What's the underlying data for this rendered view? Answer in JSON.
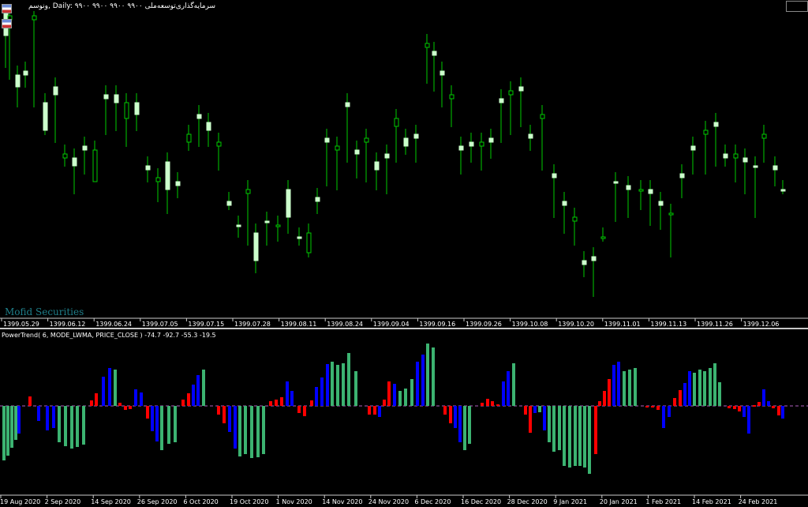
{
  "header": {
    "title": "ونوسم, Daily:  ۹۹۰۰ ۹۹۰۰ ۹۹۰۰ ۹۹۰۰  سرمایه‌گذاری‌توسعه‌ملی"
  },
  "watermark": "Mofid Securities",
  "indicator_label": "PowerTrend( 6, MODE_LWMA, PRICE_CLOSE ) -74.7 -92.7 -55.3 -19.5",
  "colors": {
    "background": "#000000",
    "bull_fill": "#ccffcc",
    "bear_outline": "#00cc00",
    "wick": "#00cc00",
    "hist_red": "#ff0000",
    "hist_blue": "#0000ff",
    "hist_green": "#3cb371",
    "zero_line": "#b060c0",
    "axis_text": "#ffffff"
  },
  "main_axis_labels": [
    "1399.05.29",
    "1399.06.12",
    "1399.06.24",
    "1399.07.05",
    "1399.07.15",
    "1399.07.28",
    "1399.08.11",
    "1399.08.24",
    "1399.09.04",
    "1399.09.16",
    "1399.09.26",
    "1399.10.08",
    "1399.10.20",
    "1399.11.01",
    "1399.11.13",
    "1399.11.26",
    "1399.12.06"
  ],
  "sub_axis_labels": [
    "19 Aug 2020",
    "2 Sep 2020",
    "14 Sep 2020",
    "26 Sep 2020",
    "6 Oct 2020",
    "19 Oct 2020",
    "1 Nov 2020",
    "14 Nov 2020",
    "24 Nov 2020",
    "6 Dec 2020",
    "16 Dec 2020",
    "28 Dec 2020",
    "9 Jan 2021",
    "20 Jan 2021",
    "1 Feb 2021",
    "14 Feb 2021",
    "24 Feb 2021"
  ],
  "chart_data": [
    {
      "type": "candlestick",
      "candles": [
        [
          5,
          45,
          15,
          80
        ],
        [
          10,
          20,
          25,
          95
        ],
        [
          20,
          110,
          95,
          130
        ],
        [
          30,
          90,
          95,
          105
        ],
        [
          41,
          20,
          25,
          130
        ],
        [
          55,
          165,
          130,
          165
        ],
        [
          68,
          110,
          120,
          175
        ],
        [
          80,
          200,
          195,
          205
        ],
        [
          92,
          200,
          210,
          240
        ],
        [
          105,
          190,
          185,
          215
        ],
        [
          118,
          190,
          230,
          195
        ],
        [
          132,
          125,
          120,
          165
        ],
        [
          145,
          120,
          130,
          160
        ],
        [
          158,
          150,
          130,
          180
        ],
        [
          171,
          145,
          130,
          160
        ],
        [
          185,
          215,
          210,
          225
        ],
        [
          198,
          230,
          225,
          250
        ],
        [
          210,
          205,
          240,
          265
        ],
        [
          223,
          230,
          235,
          245
        ],
        [
          237,
          170,
          180,
          185
        ],
        [
          250,
          145,
          150,
          180
        ],
        [
          262,
          155,
          165,
          180
        ],
        [
          275,
          185,
          180,
          210
        ],
        [
          288,
          255,
          260,
          260
        ],
        [
          300,
          285,
          285,
          295
        ],
        [
          312,
          245,
          240,
          305
        ],
        [
          322,
          295,
          330,
          340
        ],
        [
          336,
          280,
          280,
          305
        ],
        [
          350,
          285,
          285,
          300
        ],
        [
          363,
          240,
          275,
          290
        ],
        [
          377,
          300,
          300,
          305
        ],
        [
          389,
          295,
          320,
          320
        ],
        [
          400,
          255,
          250,
          265
        ],
        [
          412,
          180,
          175,
          230
        ],
        [
          425,
          185,
          190,
          235
        ],
        [
          438,
          135,
          130,
          200
        ],
        [
          450,
          195,
          190,
          220
        ],
        [
          462,
          180,
          175,
          225
        ],
        [
          475,
          205,
          215,
          235
        ],
        [
          488,
          200,
          195,
          240
        ],
        [
          500,
          160,
          150,
          200
        ],
        [
          512,
          185,
          175,
          190
        ],
        [
          525,
          175,
          170,
          200
        ],
        [
          539,
          60,
          55,
          100
        ],
        [
          548,
          70,
          65,
          110
        ],
        [
          558,
          95,
          90,
          130
        ],
        [
          570,
          125,
          120,
          155
        ],
        [
          582,
          190,
          185,
          215
        ],
        [
          595,
          185,
          180,
          200
        ],
        [
          608,
          185,
          180,
          210
        ],
        [
          620,
          180,
          175,
          195
        ],
        [
          633,
          130,
          125,
          175
        ],
        [
          645,
          120,
          115,
          165
        ],
        [
          658,
          115,
          110,
          155
        ],
        [
          670,
          175,
          170,
          185
        ],
        [
          685,
          150,
          145,
          210
        ],
        [
          700,
          225,
          220,
          270
        ],
        [
          713,
          260,
          255,
          290
        ],
        [
          726,
          280,
          275,
          305
        ],
        [
          738,
          335,
          330,
          345
        ],
        [
          750,
          325,
          330,
          370
        ],
        [
          762,
          300,
          300,
          300
        ],
        [
          778,
          230,
          230,
          275
        ],
        [
          794,
          240,
          235,
          270
        ],
        [
          810,
          240,
          240,
          260
        ],
        [
          822,
          245,
          240,
          280
        ],
        [
          835,
          260,
          255,
          285
        ],
        [
          848,
          270,
          270,
          320
        ],
        [
          862,
          225,
          220,
          245
        ],
        [
          876,
          190,
          185,
          215
        ],
        [
          892,
          170,
          165,
          215
        ],
        [
          905,
          160,
          155,
          205
        ],
        [
          917,
          200,
          195,
          205
        ],
        [
          930,
          200,
          195,
          225
        ],
        [
          942,
          205,
          200,
          240
        ],
        [
          955,
          210,
          210,
          270
        ],
        [
          966,
          175,
          170,
          200
        ],
        [
          980,
          215,
          210,
          230
        ],
        [
          990,
          240,
          240,
          240
        ]
      ]
    },
    {
      "type": "bar",
      "baseline": 514,
      "bars": [
        [
          3,
          583,
          "g"
        ],
        [
          8,
          577,
          "g"
        ],
        [
          13,
          567,
          "g"
        ],
        [
          18,
          557,
          "g"
        ],
        [
          22,
          549,
          "b"
        ],
        [
          36,
          502,
          "r"
        ],
        [
          47,
          533,
          "b"
        ],
        [
          58,
          545,
          "b"
        ],
        [
          66,
          542,
          "b"
        ],
        [
          73,
          560,
          "g"
        ],
        [
          81,
          565,
          "g"
        ],
        [
          89,
          568,
          "g"
        ],
        [
          96,
          566,
          "g"
        ],
        [
          104,
          563,
          "g"
        ],
        [
          114,
          507,
          "r"
        ],
        [
          120,
          498,
          "r"
        ],
        [
          129,
          477,
          "b"
        ],
        [
          137,
          466,
          "b"
        ],
        [
          144,
          468,
          "g"
        ],
        [
          150,
          510,
          "r"
        ],
        [
          157,
          519,
          "r"
        ],
        [
          163,
          518,
          "r"
        ],
        [
          170,
          493,
          "b"
        ],
        [
          177,
          497,
          "b"
        ],
        [
          185,
          530,
          "r"
        ],
        [
          191,
          546,
          "b"
        ],
        [
          197,
          559,
          "b"
        ],
        [
          203,
          570,
          "g"
        ],
        [
          212,
          562,
          "g"
        ],
        [
          220,
          560,
          "g"
        ],
        [
          230,
          506,
          "r"
        ],
        [
          237,
          498,
          "r"
        ],
        [
          243,
          487,
          "b"
        ],
        [
          249,
          475,
          "b"
        ],
        [
          256,
          468,
          "g"
        ],
        [
          275,
          525,
          "r"
        ],
        [
          282,
          536,
          "r"
        ],
        [
          289,
          547,
          "b"
        ],
        [
          296,
          568,
          "b"
        ],
        [
          302,
          578,
          "g"
        ],
        [
          309,
          575,
          "g"
        ],
        [
          317,
          580,
          "g"
        ],
        [
          325,
          579,
          "g"
        ],
        [
          332,
          575,
          "g"
        ],
        [
          341,
          508,
          "r"
        ],
        [
          348,
          506,
          "r"
        ],
        [
          355,
          503,
          "r"
        ],
        [
          362,
          483,
          "b"
        ],
        [
          368,
          495,
          "b"
        ],
        [
          377,
          523,
          "r"
        ],
        [
          384,
          527,
          "r"
        ],
        [
          393,
          507,
          "r"
        ],
        [
          399,
          490,
          "b"
        ],
        [
          406,
          478,
          "b"
        ],
        [
          413,
          461,
          "b"
        ],
        [
          419,
          458,
          "g"
        ],
        [
          426,
          462,
          "g"
        ],
        [
          433,
          460,
          "g"
        ],
        [
          440,
          447,
          "g"
        ],
        [
          449,
          470,
          "g"
        ],
        [
          466,
          525,
          "r"
        ],
        [
          473,
          525,
          "r"
        ],
        [
          479,
          528,
          "b"
        ],
        [
          485,
          506,
          "r"
        ],
        [
          491,
          483,
          "r"
        ],
        [
          498,
          486,
          "b"
        ],
        [
          505,
          495,
          "g"
        ],
        [
          512,
          492,
          "g"
        ],
        [
          520,
          480,
          "g"
        ],
        [
          527,
          458,
          "b"
        ],
        [
          534,
          449,
          "b"
        ],
        [
          540,
          435,
          "g"
        ],
        [
          547,
          440,
          "g"
        ],
        [
          562,
          525,
          "r"
        ],
        [
          569,
          536,
          "r"
        ],
        [
          575,
          542,
          "b"
        ],
        [
          581,
          560,
          "b"
        ],
        [
          587,
          570,
          "g"
        ],
        [
          593,
          562,
          "g"
        ],
        [
          609,
          510,
          "r"
        ],
        [
          616,
          505,
          "r"
        ],
        [
          622,
          508,
          "r"
        ],
        [
          629,
          512,
          "r"
        ],
        [
          636,
          483,
          "b"
        ],
        [
          642,
          470,
          "b"
        ],
        [
          649,
          460,
          "g"
        ],
        [
          664,
          525,
          "r"
        ],
        [
          670,
          548,
          "r"
        ],
        [
          676,
          523,
          "b"
        ],
        [
          682,
          522,
          "g"
        ],
        [
          688,
          545,
          "b"
        ],
        [
          694,
          560,
          "g"
        ],
        [
          700,
          572,
          "g"
        ],
        [
          707,
          570,
          "g"
        ],
        [
          713,
          590,
          "g"
        ],
        [
          720,
          592,
          "g"
        ],
        [
          727,
          590,
          "g"
        ],
        [
          733,
          590,
          "g"
        ],
        [
          739,
          592,
          "g"
        ],
        [
          745,
          600,
          "g"
        ],
        [
          753,
          575,
          "r"
        ],
        [
          758,
          508,
          "r"
        ],
        [
          764,
          495,
          "r"
        ],
        [
          770,
          480,
          "r"
        ],
        [
          776,
          462,
          "b"
        ],
        [
          782,
          458,
          "b"
        ],
        [
          789,
          470,
          "g"
        ],
        [
          796,
          468,
          "g"
        ],
        [
          803,
          466,
          "g"
        ],
        [
          818,
          516,
          "r"
        ],
        [
          825,
          516,
          "r"
        ],
        [
          832,
          519,
          "r"
        ],
        [
          839,
          542,
          "b"
        ],
        [
          846,
          528,
          "b"
        ],
        [
          853,
          504,
          "r"
        ],
        [
          860,
          494,
          "r"
        ],
        [
          866,
          485,
          "b"
        ],
        [
          872,
          470,
          "b"
        ],
        [
          878,
          472,
          "g"
        ],
        [
          885,
          468,
          "g"
        ],
        [
          891,
          470,
          "g"
        ],
        [
          898,
          466,
          "g"
        ],
        [
          904,
          460,
          "g"
        ],
        [
          910,
          484,
          "g"
        ],
        [
          922,
          517,
          "r"
        ],
        [
          929,
          518,
          "r"
        ],
        [
          935,
          521,
          "r"
        ],
        [
          941,
          528,
          "b"
        ],
        [
          947,
          549,
          "b"
        ],
        [
          954,
          513,
          "r"
        ],
        [
          960,
          509,
          "r"
        ],
        [
          966,
          493,
          "b"
        ],
        [
          972,
          508,
          "b"
        ],
        [
          978,
          517,
          "r"
        ],
        [
          985,
          526,
          "r"
        ],
        [
          990,
          530,
          "b"
        ]
      ]
    }
  ]
}
